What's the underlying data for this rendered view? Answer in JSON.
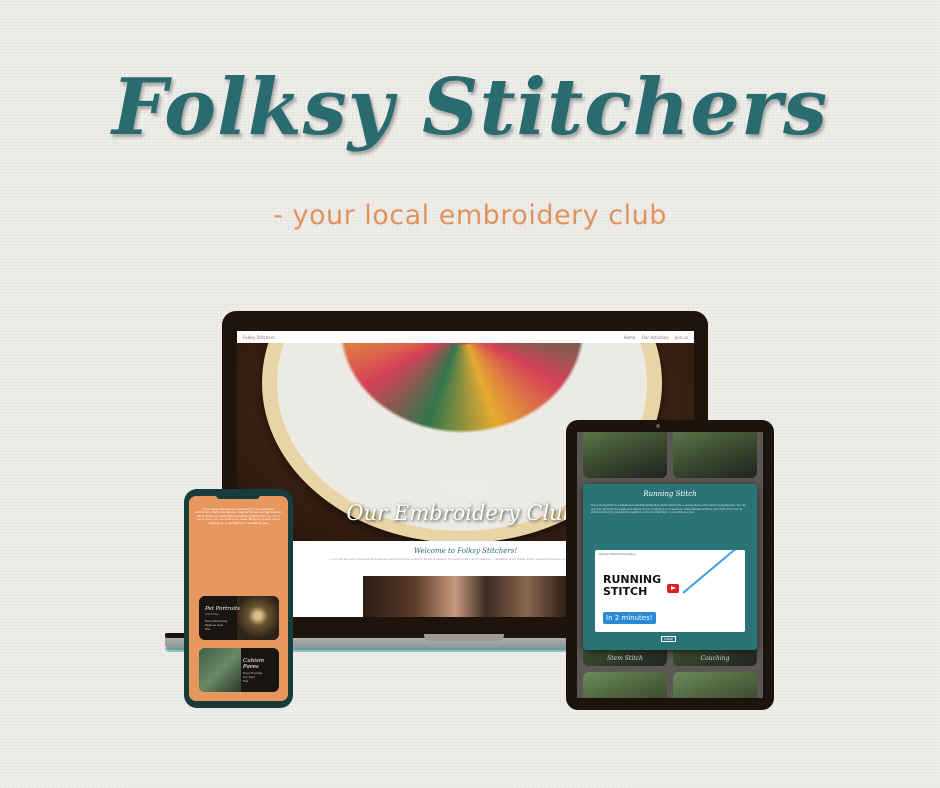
{
  "header": {
    "title": "Folksy Stitchers",
    "tagline": "- your local embroidery club"
  },
  "laptop": {
    "site_name": "Folksy Stitchers",
    "nav": [
      "Home",
      "Our Activities",
      "Join us"
    ],
    "hero_welcome": "welcome",
    "hero_title": "Our Embroidery Club!",
    "section_title": "Welcome to Folksy Stitchers!",
    "section_text": "... is a vibrant and inclusive atmosphere where friends come to share a passion for embroidery and creating ... Together we'll foster skills, swap techniques and nurture our creativity..."
  },
  "tablet": {
    "modal_title": "Running Stitch",
    "modal_text": "The running stitch is a simple and versatile embroidery stitch that holds a special place in the world of needlework. You can use it to decorate the edges and seams of your clothing and accessories, make delicate outlines, and more. The running stitch is formed by passing the needle in and out of the fabric in a continuous line.",
    "video_channel": "Studio Hand Embroidery",
    "video_title_line1": "RUNNING",
    "video_title_line2": "STITCH",
    "video_badge": "In 2 minutes!",
    "close_label": "close",
    "bg_cards": [
      "Stem Stitch",
      "Couching"
    ]
  },
  "phone": {
    "intro_text": "Here Folksy Stitchers is a community to do everything embroidery, share new designs, swap techniques and get inspired. We're excited to share these wonderful projects with you, and if you'd like to join, we meet every week. Bring any project you're working on, or get started on something new.",
    "cards": [
      {
        "title": "Pet Portraits",
        "sub": "with Folksy",
        "meta": [
          "Every Wednesday",
          "Beginner level",
          "Free"
        ]
      },
      {
        "title": "Cubism Faces",
        "sub": "with Folksy",
        "meta": [
          "Every Thursday",
          "Any level",
          "Free"
        ]
      }
    ]
  }
}
